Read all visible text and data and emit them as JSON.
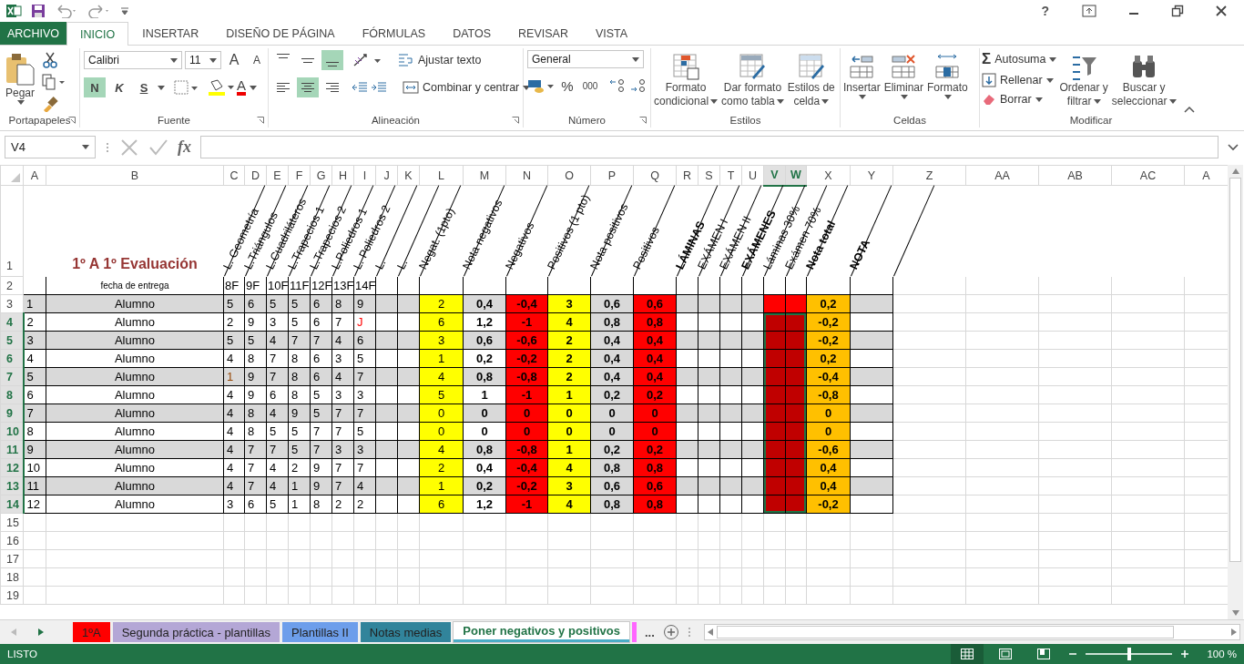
{
  "window": {
    "help": "?"
  },
  "ribbon_tabs": [
    {
      "label": "ARCHIVO",
      "kind": "file",
      "selected": false
    },
    {
      "label": "INICIO",
      "kind": "tab",
      "selected": true
    },
    {
      "label": "INSERTAR",
      "kind": "tab",
      "selected": false
    },
    {
      "label": "DISEÑO DE PÁGINA",
      "kind": "tab",
      "selected": false
    },
    {
      "label": "FÓRMULAS",
      "kind": "tab",
      "selected": false
    },
    {
      "label": "DATOS",
      "kind": "tab",
      "selected": false
    },
    {
      "label": "REVISAR",
      "kind": "tab",
      "selected": false
    },
    {
      "label": "VISTA",
      "kind": "tab",
      "selected": false
    }
  ],
  "ribbon": {
    "clipboard": {
      "group": "Portapapeles",
      "paste": "Pegar"
    },
    "font": {
      "group": "Fuente",
      "family": "Calibri",
      "size": "11",
      "grow": "A",
      "shrink": "A",
      "color_letter": "A",
      "styles": [
        {
          "label": "N",
          "on": true
        },
        {
          "label": "K",
          "on": false
        },
        {
          "label": "S",
          "on": false
        }
      ]
    },
    "alignment": {
      "group": "Alineación",
      "vertical": [
        {
          "on": false
        },
        {
          "on": false
        },
        {
          "on": true
        }
      ],
      "horizontal": [
        {
          "on": false
        },
        {
          "on": true
        },
        {
          "on": false
        }
      ],
      "wrap": "Ajustar texto",
      "merge": "Combinar y centrar"
    },
    "number": {
      "group": "Número",
      "format": "General",
      "percent": "%",
      "thousands": "000"
    },
    "styles": {
      "group": "Estilos",
      "buttons": [
        {
          "lines": [
            "Formato",
            "condicional"
          ]
        },
        {
          "lines": [
            "Dar formato",
            "como tabla"
          ]
        },
        {
          "lines": [
            "Estilos de",
            "celda"
          ]
        }
      ]
    },
    "cells": {
      "group": "Celdas",
      "buttons": [
        "Insertar",
        "Eliminar",
        "Formato"
      ]
    },
    "editing": {
      "group": "Modificar",
      "sum_symbol": "Σ",
      "small": [
        "Autosuma",
        "Rellenar",
        "Borrar"
      ],
      "big": [
        {
          "lines": [
            "Ordenar y",
            "filtrar"
          ]
        },
        {
          "lines": [
            "Buscar y",
            "seleccionar"
          ]
        }
      ]
    }
  },
  "formula_bar": {
    "name_box": "V4",
    "function_label": "fx"
  },
  "columns": [
    {
      "label": "A",
      "selected": false
    },
    {
      "label": "B",
      "selected": false
    },
    {
      "label": "C",
      "selected": false
    },
    {
      "label": "D",
      "selected": false
    },
    {
      "label": "E",
      "selected": false
    },
    {
      "label": "F",
      "selected": false
    },
    {
      "label": "G",
      "selected": false
    },
    {
      "label": "H",
      "selected": false
    },
    {
      "label": "I",
      "selected": false
    },
    {
      "label": "J",
      "selected": false
    },
    {
      "label": "K",
      "selected": false
    },
    {
      "label": "L",
      "selected": false
    },
    {
      "label": "M",
      "selected": false
    },
    {
      "label": "N",
      "selected": false
    },
    {
      "label": "O",
      "selected": false
    },
    {
      "label": "P",
      "selected": false
    },
    {
      "label": "Q",
      "selected": false
    },
    {
      "label": "R",
      "selected": false
    },
    {
      "label": "S",
      "selected": false
    },
    {
      "label": "T",
      "selected": false
    },
    {
      "label": "U",
      "selected": false
    },
    {
      "label": "V",
      "selected": true
    },
    {
      "label": "W",
      "selected": true
    },
    {
      "label": "X",
      "selected": false
    },
    {
      "label": "Y",
      "selected": false
    },
    {
      "label": "Z",
      "selected": false
    },
    {
      "label": "AA",
      "selected": false
    },
    {
      "label": "AB",
      "selected": false
    },
    {
      "label": "AC",
      "selected": false
    },
    {
      "label": "A",
      "selected": false
    }
  ],
  "sheet": {
    "row1_header": "1",
    "row2_header": "2",
    "title": "1º A 1º Evaluación",
    "headers": [
      {
        "text": "L. Geometría",
        "bold": false
      },
      {
        "text": "L.Triángulos",
        "bold": false
      },
      {
        "text": "L.Cuadriláteros",
        "bold": false
      },
      {
        "text": "L.Trapecios 1",
        "bold": false
      },
      {
        "text": "L.Trapecios 2",
        "bold": false
      },
      {
        "text": "L.Poliedros 1",
        "bold": false
      },
      {
        "text": "L. Poliedros 2",
        "bold": false
      },
      {
        "text": "L.",
        "bold": false
      },
      {
        "text": "L.",
        "bold": false
      },
      {
        "text": "Negat. (1pto)",
        "bold": false
      },
      {
        "text": "Nota negativos",
        "bold": false
      },
      {
        "text": "Negativos",
        "bold": false
      },
      {
        "text": "Positivos (1 pto)",
        "bold": false
      },
      {
        "text": "Nota positivos",
        "bold": false
      },
      {
        "text": "Positivos",
        "bold": false
      },
      {
        "text": "LÁMINAS",
        "bold": true
      },
      {
        "text": "EXÁMEN I",
        "bold": false
      },
      {
        "text": "EXÁMEN II",
        "bold": false
      },
      {
        "text": "EXÁMENES",
        "bold": true
      },
      {
        "text": "Láminas 30%",
        "bold": false
      },
      {
        "text": "Exámen 70%",
        "bold": false
      },
      {
        "text": "Nota total",
        "bold": true
      },
      {
        "text": "NOTA",
        "bold": true
      }
    ],
    "date_label": "fecha de entrega",
    "dates": [
      "8F",
      "9F",
      "10F",
      "11F",
      "12F",
      "13F",
      "14F"
    ]
  },
  "rows": [
    {
      "header": "3",
      "selected": false,
      "number": "1",
      "name": "Alumno",
      "grades": [
        {
          "text": "5",
          "color": "#000000"
        },
        {
          "text": "6",
          "color": "#000000"
        },
        {
          "text": "5",
          "color": "#000000"
        },
        {
          "text": "5",
          "color": "#000000"
        },
        {
          "text": "6",
          "color": "#000000"
        },
        {
          "text": "8",
          "color": "#000000"
        },
        {
          "text": "9",
          "color": "#000000"
        }
      ],
      "values": [
        "2",
        "0,4",
        "-0,4",
        "3",
        "0,6",
        "0,6"
      ],
      "color": "#ff0000",
      "total": "0,2"
    },
    {
      "header": "4",
      "selected": true,
      "number": "2",
      "name": "Alumno",
      "grades": [
        {
          "text": "2",
          "color": "#000000"
        },
        {
          "text": "9",
          "color": "#000000"
        },
        {
          "text": "3",
          "color": "#000000"
        },
        {
          "text": "5",
          "color": "#000000"
        },
        {
          "text": "6",
          "color": "#000000"
        },
        {
          "text": "7",
          "color": "#000000"
        },
        {
          "text": "J",
          "color": "#ff0000"
        }
      ],
      "values": [
        "6",
        "1,2",
        "-1",
        "4",
        "0,8",
        "0,8"
      ],
      "color": "#c00000",
      "total": "-0,2"
    },
    {
      "header": "5",
      "selected": true,
      "number": "3",
      "name": "Alumno",
      "grades": [
        {
          "text": "5",
          "color": "#000000"
        },
        {
          "text": "5",
          "color": "#000000"
        },
        {
          "text": "4",
          "color": "#000000"
        },
        {
          "text": "7",
          "color": "#000000"
        },
        {
          "text": "7",
          "color": "#000000"
        },
        {
          "text": "4",
          "color": "#000000"
        },
        {
          "text": "6",
          "color": "#000000"
        }
      ],
      "values": [
        "3",
        "0,6",
        "-0,6",
        "2",
        "0,4",
        "0,4"
      ],
      "color": "#c00000",
      "total": "-0,2"
    },
    {
      "header": "6",
      "selected": true,
      "number": "4",
      "name": "Alumno",
      "grades": [
        {
          "text": "4",
          "color": "#000000"
        },
        {
          "text": "8",
          "color": "#000000"
        },
        {
          "text": "7",
          "color": "#000000"
        },
        {
          "text": "8",
          "color": "#000000"
        },
        {
          "text": "6",
          "color": "#000000"
        },
        {
          "text": "3",
          "color": "#000000"
        },
        {
          "text": "5",
          "color": "#000000"
        }
      ],
      "values": [
        "1",
        "0,2",
        "-0,2",
        "2",
        "0,4",
        "0,4"
      ],
      "color": "#c00000",
      "total": "0,2"
    },
    {
      "header": "7",
      "selected": true,
      "number": "5",
      "name": "Alumno",
      "grades": [
        {
          "text": "1",
          "color": "#974706"
        },
        {
          "text": "9",
          "color": "#000000"
        },
        {
          "text": "7",
          "color": "#000000"
        },
        {
          "text": "8",
          "color": "#000000"
        },
        {
          "text": "6",
          "color": "#000000"
        },
        {
          "text": "4",
          "color": "#000000"
        },
        {
          "text": "7",
          "color": "#000000"
        }
      ],
      "values": [
        "4",
        "0,8",
        "-0,8",
        "2",
        "0,4",
        "0,4"
      ],
      "color": "#c00000",
      "total": "-0,4"
    },
    {
      "header": "8",
      "selected": true,
      "number": "6",
      "name": "Alumno",
      "grades": [
        {
          "text": "4",
          "color": "#000000"
        },
        {
          "text": "9",
          "color": "#000000"
        },
        {
          "text": "6",
          "color": "#000000"
        },
        {
          "text": "8",
          "color": "#000000"
        },
        {
          "text": "5",
          "color": "#000000"
        },
        {
          "text": "3",
          "color": "#000000"
        },
        {
          "text": "3",
          "color": "#000000"
        }
      ],
      "values": [
        "5",
        "1",
        "-1",
        "1",
        "0,2",
        "0,2"
      ],
      "color": "#c00000",
      "total": "-0,8"
    },
    {
      "header": "9",
      "selected": true,
      "number": "7",
      "name": "Alumno",
      "grades": [
        {
          "text": "4",
          "color": "#000000"
        },
        {
          "text": "8",
          "color": "#000000"
        },
        {
          "text": "4",
          "color": "#000000"
        },
        {
          "text": "9",
          "color": "#000000"
        },
        {
          "text": "5",
          "color": "#000000"
        },
        {
          "text": "7",
          "color": "#000000"
        },
        {
          "text": "7",
          "color": "#000000"
        }
      ],
      "values": [
        "0",
        "0",
        "0",
        "0",
        "0",
        "0"
      ],
      "color": "#c00000",
      "total": "0"
    },
    {
      "header": "10",
      "selected": true,
      "number": "8",
      "name": "Alumno",
      "grades": [
        {
          "text": "4",
          "color": "#000000"
        },
        {
          "text": "8",
          "color": "#000000"
        },
        {
          "text": "5",
          "color": "#000000"
        },
        {
          "text": "5",
          "color": "#000000"
        },
        {
          "text": "7",
          "color": "#000000"
        },
        {
          "text": "7",
          "color": "#000000"
        },
        {
          "text": "5",
          "color": "#000000"
        }
      ],
      "values": [
        "0",
        "0",
        "0",
        "0",
        "0",
        "0"
      ],
      "color": "#c00000",
      "total": "0"
    },
    {
      "header": "11",
      "selected": true,
      "number": "9",
      "name": "Alumno",
      "grades": [
        {
          "text": "4",
          "color": "#000000"
        },
        {
          "text": "7",
          "color": "#000000"
        },
        {
          "text": "7",
          "color": "#000000"
        },
        {
          "text": "5",
          "color": "#000000"
        },
        {
          "text": "7",
          "color": "#000000"
        },
        {
          "text": "3",
          "color": "#000000"
        },
        {
          "text": "3",
          "color": "#000000"
        }
      ],
      "values": [
        "4",
        "0,8",
        "-0,8",
        "1",
        "0,2",
        "0,2"
      ],
      "color": "#c00000",
      "total": "-0,6"
    },
    {
      "header": "12",
      "selected": true,
      "number": "10",
      "name": "Alumno",
      "grades": [
        {
          "text": "4",
          "color": "#000000"
        },
        {
          "text": "7",
          "color": "#000000"
        },
        {
          "text": "4",
          "color": "#000000"
        },
        {
          "text": "2",
          "color": "#000000"
        },
        {
          "text": "9",
          "color": "#000000"
        },
        {
          "text": "7",
          "color": "#000000"
        },
        {
          "text": "7",
          "color": "#000000"
        }
      ],
      "values": [
        "2",
        "0,4",
        "-0,4",
        "4",
        "0,8",
        "0,8"
      ],
      "color": "#c00000",
      "total": "0,4"
    },
    {
      "header": "13",
      "selected": true,
      "number": "11",
      "name": "Alumno",
      "grades": [
        {
          "text": "4",
          "color": "#000000"
        },
        {
          "text": "7",
          "color": "#000000"
        },
        {
          "text": "4",
          "color": "#000000"
        },
        {
          "text": "1",
          "color": "#000000"
        },
        {
          "text": "9",
          "color": "#000000"
        },
        {
          "text": "7",
          "color": "#000000"
        },
        {
          "text": "4",
          "color": "#000000"
        }
      ],
      "values": [
        "1",
        "0,2",
        "-0,2",
        "3",
        "0,6",
        "0,6"
      ],
      "color": "#c00000",
      "total": "0,4"
    },
    {
      "header": "14",
      "selected": true,
      "number": "12",
      "name": "Alumno",
      "grades": [
        {
          "text": "3",
          "color": "#000000"
        },
        {
          "text": "6",
          "color": "#000000"
        },
        {
          "text": "5",
          "color": "#000000"
        },
        {
          "text": "1",
          "color": "#000000"
        },
        {
          "text": "8",
          "color": "#000000"
        },
        {
          "text": "2",
          "color": "#000000"
        },
        {
          "text": "2",
          "color": "#000000"
        }
      ],
      "values": [
        "6",
        "1,2",
        "-1",
        "4",
        "0,8",
        "0,8"
      ],
      "color": "#c00000",
      "total": "-0,2"
    }
  ],
  "empty_rows": [
    "15",
    "16",
    "17",
    "18",
    "19"
  ],
  "sheet_tabs": [
    {
      "kind": "tab",
      "label": "1ºA",
      "color": "#ff0000",
      "selected": false
    },
    {
      "kind": "tab",
      "label": "Segunda práctica - plantillas",
      "color": "#b4a7d6",
      "selected": false
    },
    {
      "kind": "tab",
      "label": "Plantillas II",
      "color": "#6d9eeb",
      "selected": false
    },
    {
      "kind": "tab",
      "label": "Notas medias",
      "color": "#31849b",
      "selected": false
    },
    {
      "kind": "tab",
      "label": "Poner negativos y positivos",
      "color": "#4bacc6",
      "selected": true
    },
    {
      "kind": "stub",
      "color": "#ff66ff",
      "selected": false
    }
  ],
  "more_sheets": "...",
  "status_bar": {
    "status": "LISTO",
    "views": [
      {
        "selected": true
      },
      {
        "selected": false
      },
      {
        "selected": false
      }
    ],
    "zoom": {
      "level": 0.5,
      "label": "100 %"
    }
  }
}
